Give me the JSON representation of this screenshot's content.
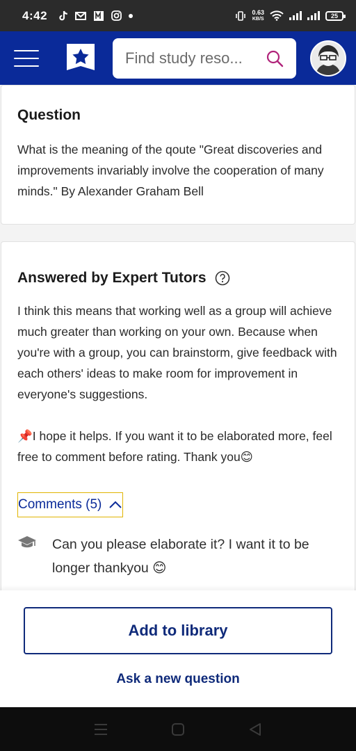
{
  "status_bar": {
    "time": "4:42",
    "network_speed_value": "0.63",
    "network_speed_unit": "KB/S",
    "battery": "25"
  },
  "header": {
    "search_placeholder": "Find study reso..."
  },
  "question_card": {
    "heading": "Question",
    "text": "What is the meaning of the qoute \"Great discoveries and improvements invariably involve the cooperation of many minds.\" By Alexander Graham Bell"
  },
  "answer_card": {
    "heading": "Answered by Expert Tutors",
    "paragraph_1": "I think this means that working well as a group will achieve much greater than working on your own. Because when you're with a group, you can brainstorm, give feedback with each others' ideas to make room for improvement in everyone's suggestions.",
    "paragraph_2": "📌I hope it helps. If you want it to be elaborated more, feel free to comment before rating. Thank you😊",
    "comments_label": "Comments (5)",
    "comments": [
      {
        "text": "Can you please elaborate it? I want it to be longer thankyou 😊"
      }
    ]
  },
  "actions": {
    "add_to_library": "Add to library",
    "ask_new_question": "Ask a new question"
  },
  "colors": {
    "brand_blue": "#0a2a99",
    "button_text": "#0f2a7a",
    "focus_outline": "#e0b400"
  },
  "icons": [
    "tiktok-icon",
    "gmail-icon",
    "news-icon",
    "instagram-icon",
    "vibrate-icon",
    "wifi-icon",
    "signal-icon",
    "battery-icon",
    "menu-icon",
    "star-bookmark-logo",
    "search-icon",
    "avatar",
    "help-icon",
    "chevron-up-icon",
    "graduation-cap-icon",
    "recents-icon",
    "home-icon",
    "back-icon"
  ]
}
